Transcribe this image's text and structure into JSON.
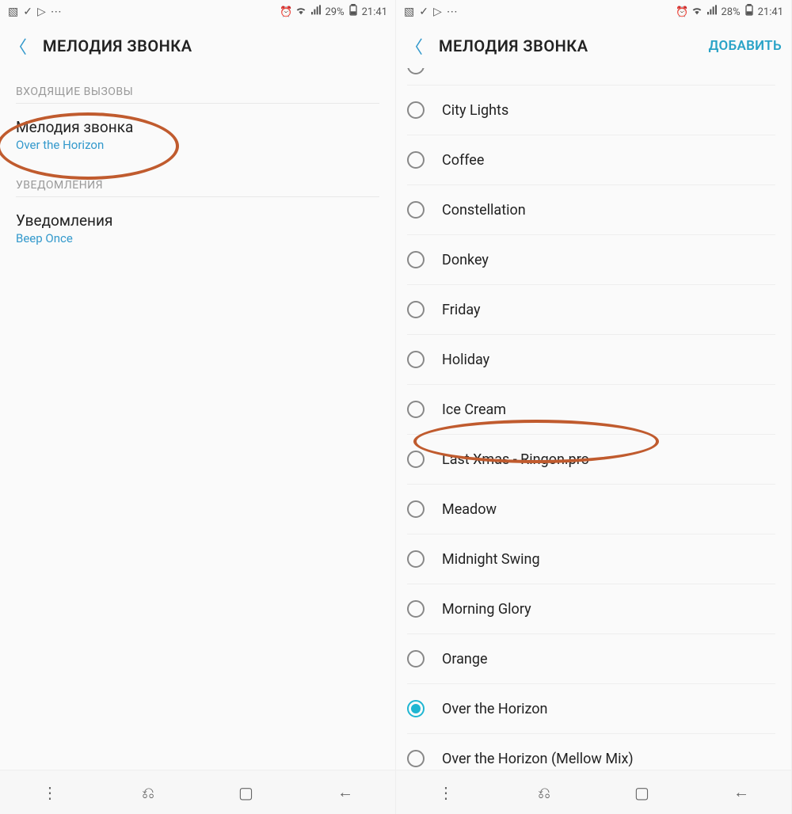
{
  "left": {
    "status": {
      "battery": "29%",
      "time": "21:41"
    },
    "header": {
      "title": "МЕЛОДИЯ ЗВОНКА"
    },
    "sections": {
      "incoming_label": "ВХОДЯЩИЕ ВЫЗОВЫ",
      "ringtone_title": "Мелодия звонка",
      "ringtone_value": "Over the Horizon",
      "notifications_label": "УВЕДОМЛЕНИЯ",
      "notif_title": "Уведомления",
      "notif_value": "Beep Once"
    }
  },
  "right": {
    "status": {
      "battery": "28%",
      "time": "21:41"
    },
    "header": {
      "title": "МЕЛОДИЯ ЗВОНКА",
      "action": "ДОБАВИТЬ"
    },
    "ringtones": [
      {
        "label": "City Lights",
        "selected": false
      },
      {
        "label": "Coffee",
        "selected": false
      },
      {
        "label": "Constellation",
        "selected": false
      },
      {
        "label": "Donkey",
        "selected": false
      },
      {
        "label": "Friday",
        "selected": false
      },
      {
        "label": "Holiday",
        "selected": false
      },
      {
        "label": "Ice Cream",
        "selected": false
      },
      {
        "label": "Last Xmas - Ringon.pro",
        "selected": false
      },
      {
        "label": "Meadow",
        "selected": false
      },
      {
        "label": "Midnight Swing",
        "selected": false
      },
      {
        "label": "Morning Glory",
        "selected": false
      },
      {
        "label": "Orange",
        "selected": false
      },
      {
        "label": "Over the Horizon",
        "selected": true
      },
      {
        "label": "Over the Horizon (Mellow Mix)",
        "selected": false
      }
    ]
  },
  "highlight_index": 7,
  "colors": {
    "accent": "#3399cc",
    "annotation": "#c05b2e"
  }
}
